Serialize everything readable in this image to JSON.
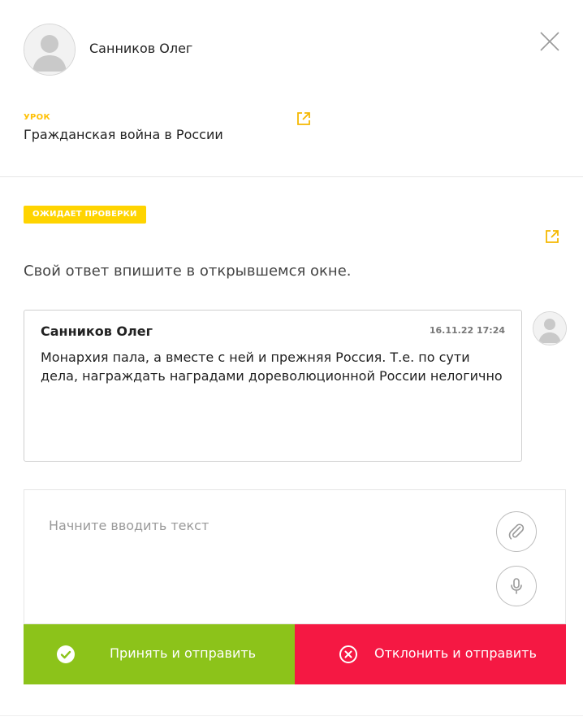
{
  "header": {
    "user_name": "Санников Олег"
  },
  "lesson": {
    "label": "УРОК",
    "title": "Гражданская война в России"
  },
  "status": {
    "label": "ОЖИДАЕТ ПРОВЕРКИ",
    "color": "#ffd400"
  },
  "instruction": "Свой ответ впишите в открывшемся окне.",
  "answer": {
    "author": "Санников Олег",
    "timestamp": "16.11.22 17:24",
    "text": "Монархия пала, а вместе с ней и прежняя Россия. Т.е. по сути дела, награждать наградами дореволюционной России нелогично"
  },
  "reply": {
    "placeholder": "Начните вводить текст",
    "value": ""
  },
  "actions": {
    "accept_label": "Принять и отправить",
    "reject_label": "Отклонить и отправить",
    "accept_color": "#8cc31a",
    "reject_color": "#f51843"
  },
  "icons": {
    "close": "close-icon",
    "external_link": "external-link-icon",
    "attach": "paperclip-icon",
    "mic": "microphone-icon",
    "accept": "check-circle-icon",
    "reject": "x-circle-icon",
    "avatar": "user-avatar-icon"
  }
}
